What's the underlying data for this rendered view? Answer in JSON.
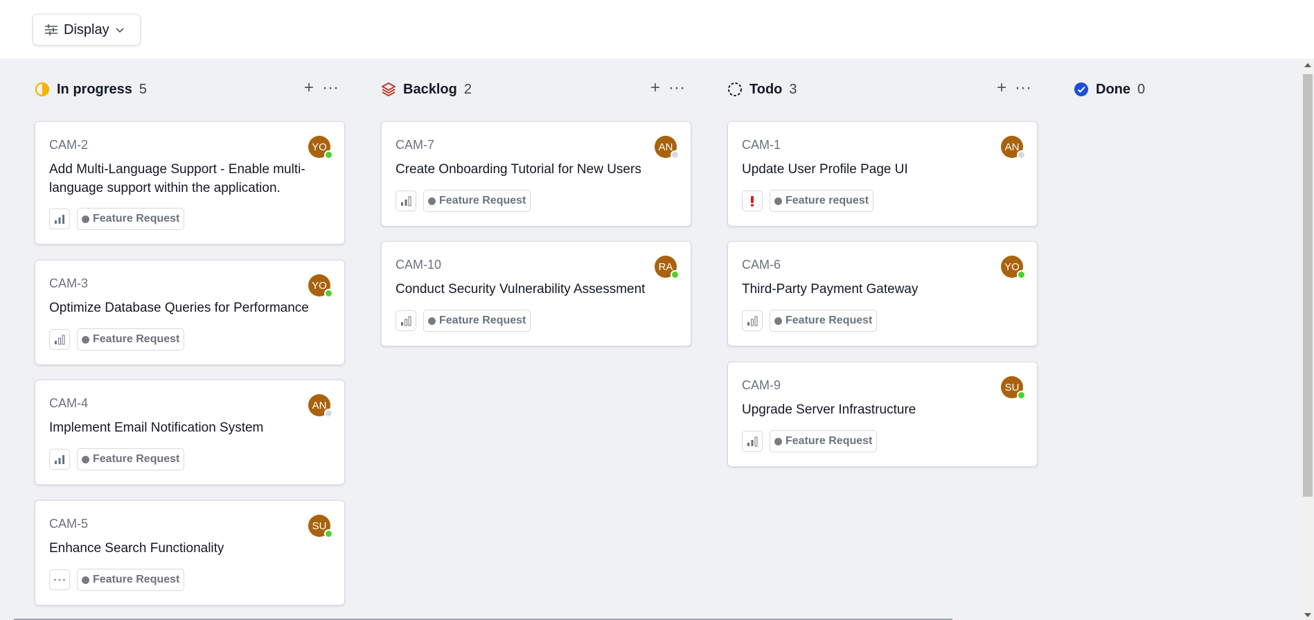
{
  "toolbar": {
    "display_label": "Display"
  },
  "columns": [
    {
      "title": "In progress",
      "count": "5",
      "icon": "half-circle-icon",
      "color": "#f5b301"
    },
    {
      "title": "Backlog",
      "count": "2",
      "icon": "layers-icon",
      "color": "#c0392b"
    },
    {
      "title": "Todo",
      "count": "3",
      "icon": "dashed-circle-icon",
      "color": "#111827"
    },
    {
      "title": "Done",
      "count": "0",
      "icon": "check-circle-icon",
      "color": "#1d4ed8"
    }
  ],
  "cards": {
    "inprogress": [
      {
        "id": "CAM-2",
        "title": "Add Multi-Language Support - Enable multi-language support within the application.",
        "avatar": "YO",
        "status": "online",
        "priority": "medium-high",
        "label": "Feature Request"
      },
      {
        "id": "CAM-3",
        "title": "Optimize Database Queries for Performance",
        "avatar": "YO",
        "status": "online",
        "priority": "low",
        "label": "Feature Request"
      },
      {
        "id": "CAM-4",
        "title": "Implement Email Notification System",
        "avatar": "AN",
        "status": "offline",
        "priority": "medium-high",
        "label": "Feature Request"
      },
      {
        "id": "CAM-5",
        "title": "Enhance Search Functionality",
        "avatar": "SU",
        "status": "online",
        "priority": "none",
        "label": "Feature Request"
      }
    ],
    "backlog": [
      {
        "id": "CAM-7",
        "title": "Create Onboarding Tutorial for New Users",
        "avatar": "AN",
        "status": "offline",
        "priority": "medium",
        "label": "Feature Request"
      },
      {
        "id": "CAM-10",
        "title": "Conduct Security Vulnerability Assessment",
        "avatar": "RA",
        "status": "online",
        "priority": "low",
        "label": "Feature Request"
      }
    ],
    "todo": [
      {
        "id": "CAM-1",
        "title": "Update User Profile Page UI",
        "avatar": "AN",
        "status": "offline",
        "priority": "urgent",
        "label": "Feature request"
      },
      {
        "id": "CAM-6",
        "title": "Third-Party Payment Gateway",
        "avatar": "YO",
        "status": "online",
        "priority": "low",
        "label": "Feature Request"
      },
      {
        "id": "CAM-9",
        "title": "Upgrade Server Infrastructure",
        "avatar": "SU",
        "status": "online",
        "priority": "medium",
        "label": "Feature Request"
      }
    ]
  },
  "colors": {
    "avatar_bg": "#a9620d",
    "online": "#4cd232",
    "offline": "#d5d9e0",
    "board_bg": "#f0f1f4"
  }
}
